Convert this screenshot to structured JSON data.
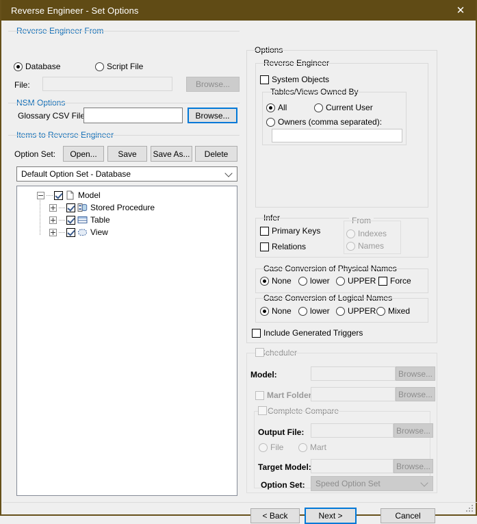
{
  "window": {
    "title": "Reverse Engineer - Set Options",
    "close_icon": "close-icon",
    "titlebar_color": "#604b15"
  },
  "left_panel": {
    "reverse_engineer_from": {
      "legend": "Reverse Engineer From",
      "options": [
        {
          "label": "Database",
          "selected": true
        },
        {
          "label": "Script File",
          "selected": false
        }
      ],
      "file_label": "File:",
      "file_value": "",
      "file_placeholder": "",
      "browse_label": "Browse...",
      "browse_enabled": false
    },
    "nsm_options": {
      "legend": "NSM Options",
      "glossary_label": "Glossary CSV File:",
      "glossary_value": "",
      "glossary_placeholder": "",
      "browse_label": "Browse...",
      "browse_focused": true
    },
    "items_to_reverse_engineer": {
      "legend": "Items to Reverse Engineer",
      "option_set_label": "Option Set:",
      "buttons": [
        {
          "label": "Open..."
        },
        {
          "label": "Save"
        },
        {
          "label": "Save As..."
        },
        {
          "label": "Delete"
        }
      ],
      "option_set_combo_value": "Default Option Set - Database",
      "tree": [
        {
          "label": "Model",
          "icon": "document-icon",
          "checked": true,
          "expander": "minus",
          "depth": 0
        },
        {
          "label": "Stored Procedure",
          "icon": "stored-procedure-icon",
          "checked": true,
          "expander": "plus",
          "depth": 1
        },
        {
          "label": "Table",
          "icon": "table-icon",
          "checked": true,
          "expander": "plus",
          "depth": 1
        },
        {
          "label": "View",
          "icon": "view-icon",
          "checked": true,
          "expander": "plus",
          "depth": 1
        }
      ]
    }
  },
  "right_panel": {
    "options_legend": "Options",
    "reverse_engineer": {
      "legend": "Reverse Engineer",
      "system_objects": {
        "label": "System Objects",
        "checked": false
      },
      "tables_views_owned_by": {
        "legend": "Tables/Views Owned By",
        "options": [
          {
            "label": "All",
            "selected": true
          },
          {
            "label": "Current User",
            "selected": false
          },
          {
            "label": "Owners (comma separated):",
            "selected": false
          }
        ],
        "owners_value": "",
        "owners_placeholder": ""
      }
    },
    "infer": {
      "legend": "Infer",
      "checks": [
        {
          "label": "Primary Keys",
          "checked": false
        },
        {
          "label": "Relations",
          "checked": false
        }
      ],
      "from": {
        "legend": "From",
        "enabled": false,
        "options": [
          {
            "label": "Indexes",
            "selected": false
          },
          {
            "label": "Names",
            "selected": false
          }
        ]
      }
    },
    "case_physical": {
      "legend": "Case Conversion of Physical Names",
      "options": [
        {
          "label": "None",
          "selected": true
        },
        {
          "label": "lower",
          "selected": false
        },
        {
          "label": "UPPER",
          "selected": false
        }
      ],
      "force": {
        "label": "Force",
        "checked": false
      }
    },
    "case_logical": {
      "legend": "Case Conversion of Logical Names",
      "options": [
        {
          "label": "None",
          "selected": true
        },
        {
          "label": "lower",
          "selected": false
        },
        {
          "label": "UPPER",
          "selected": false
        },
        {
          "label": "Mixed",
          "selected": false
        }
      ]
    },
    "include_generated_triggers": {
      "label": "Include Generated Triggers",
      "checked": false
    },
    "scheduler": {
      "legend": "Scheduler",
      "checked": false,
      "enabled": false,
      "model_label": "Model:",
      "model_value": "",
      "model_browse": "Browse...",
      "mart_folder_label": "Mart Folder:",
      "mart_folder_checked": false,
      "mart_folder_value": "",
      "mart_folder_browse": "Browse...",
      "complete_compare": {
        "legend": "Complete Compare",
        "checked": false,
        "output_file_label": "Output File:",
        "output_file_value": "",
        "output_file_browse": "Browse...",
        "source_options": [
          {
            "label": "File",
            "selected": true
          },
          {
            "label": "Mart",
            "selected": false
          }
        ],
        "target_model_label": "Target Model:",
        "target_model_value": "",
        "target_model_browse": "Browse...",
        "option_set_label": "Option Set:",
        "option_set_value": "Speed Option Set"
      }
    }
  },
  "footer": {
    "back_label": "< Back",
    "next_label": "Next >",
    "cancel_label": "Cancel",
    "next_focused": true
  }
}
